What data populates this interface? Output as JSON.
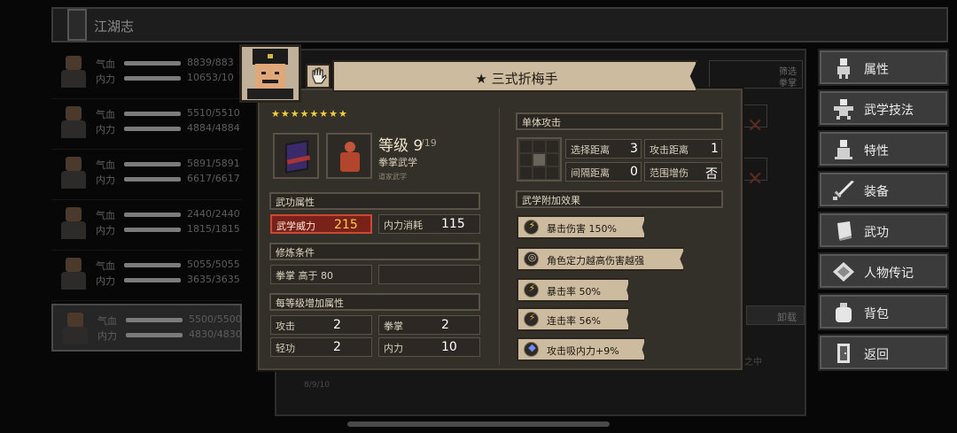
{
  "background": {
    "title": "江湖志",
    "characters": [
      {
        "hp_label": "气血",
        "hp": "8839/883",
        "mp_label": "内力",
        "mp": "10653/10"
      },
      {
        "hp_label": "气血",
        "hp": "5510/5510",
        "mp_label": "内力",
        "mp": "4884/4884"
      },
      {
        "hp_label": "气血",
        "hp": "5891/5891",
        "mp_label": "内力",
        "mp": "6617/6617"
      },
      {
        "hp_label": "气血",
        "hp": "2440/2440",
        "mp_label": "内力",
        "mp": "1815/1815"
      },
      {
        "hp_label": "气血",
        "hp": "5055/5055",
        "mp_label": "内力",
        "mp": "3635/3635"
      },
      {
        "hp_label": "气血",
        "hp": "5500/5500",
        "mp_label": "内力",
        "mp": "4830/4830"
      }
    ],
    "filter_label": "筛选",
    "filter_value": "拳掌",
    "unequip_label": "卸载",
    "tail_text": "之中",
    "tail_text2": "8/9/10"
  },
  "side_menu": [
    {
      "label": "属性",
      "icon": "person-icon"
    },
    {
      "label": "武学技法",
      "icon": "martial-arts-icon"
    },
    {
      "label": "特性",
      "icon": "trait-icon"
    },
    {
      "label": "装备",
      "icon": "sword-icon"
    },
    {
      "label": "武功",
      "icon": "book-icon"
    },
    {
      "label": "人物传记",
      "icon": "scroll-icon"
    },
    {
      "label": "背包",
      "icon": "bag-icon"
    },
    {
      "label": "返回",
      "icon": "door-icon"
    }
  ],
  "dialog": {
    "title": "★ 三式折梅手",
    "stars": "★★★★★★★★",
    "level_label": "等级 9",
    "level_max": "/19",
    "school": "拳掌武学",
    "school_sub": "道家武学",
    "attr_section": "武功属性",
    "power_label": "武学威力",
    "power_value": "215",
    "cost_label": "内力消耗",
    "cost_value": "115",
    "req_section": "修炼条件",
    "req_text": "拳掌 高于 80",
    "perlevel_section": "每等级增加属性",
    "perlevel": [
      {
        "label": "攻击",
        "value": "2"
      },
      {
        "label": "拳掌",
        "value": "2"
      },
      {
        "label": "轻功",
        "value": "2"
      },
      {
        "label": "内力",
        "value": "10"
      }
    ],
    "attack_type": "单体攻击",
    "select_range_label": "选择距离",
    "select_range_value": "3",
    "attack_range_label": "攻击距离",
    "attack_range_value": "1",
    "interval_range_label": "间隔距离",
    "interval_range_value": "0",
    "aoe_label": "范围增伤",
    "aoe_value": "否",
    "effects_section": "武学附加效果",
    "effects": [
      {
        "text": "暴击伤害  150%",
        "icon": "crit-damage-icon"
      },
      {
        "text": "角色定力越高伤害越强",
        "icon": "focus-icon"
      },
      {
        "text": "暴击率  50%",
        "icon": "crit-rate-icon"
      },
      {
        "text": "连击率  56%",
        "icon": "combo-icon"
      },
      {
        "text": "攻击吸内力+9%",
        "icon": "drain-icon"
      }
    ]
  }
}
